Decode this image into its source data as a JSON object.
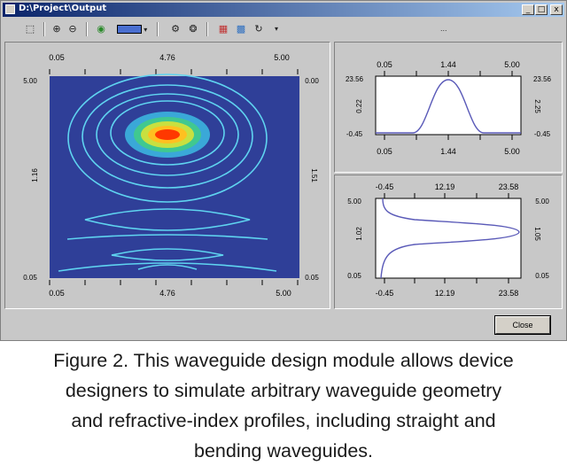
{
  "window": {
    "title": "D:\\Project\\Output",
    "controls": [
      "_",
      "□",
      "x"
    ],
    "close_label": "Close",
    "right_toolbar_dots": "..."
  },
  "toolbar": {
    "icons": [
      "pointer-icon",
      "zoom-in-icon",
      "zoom-out-icon",
      "view-icon",
      "color-bar-dropdown",
      "settings-icon",
      "render-icon",
      "palette-icon",
      "map-icon",
      "rotate-icon",
      "more-icon"
    ]
  },
  "colors": {
    "plot_background": "#2f3f98",
    "contour": "#5fd4f0",
    "curve": "#5a5ab8",
    "hot_core": "#ff3800"
  },
  "main_plot": {
    "top_ticks": [
      "0.05",
      "4.76",
      "5.00"
    ],
    "bottom_ticks": [
      "0.05",
      "4.76",
      "5.00"
    ],
    "left_ticks": [
      "5.00",
      "1.16",
      "0.05"
    ],
    "right_ticks": [
      "0.00",
      "1.51",
      "0.05"
    ]
  },
  "top_right_plot": {
    "top_ticks": [
      "0.05",
      "1.44",
      "5.00"
    ],
    "bottom_ticks": [
      "0.05",
      "1.44",
      "5.00"
    ],
    "left_ticks": [
      "23.56",
      "0.22",
      "-0.45"
    ],
    "right_ticks": [
      "23.56",
      "2.25",
      "-0.45"
    ]
  },
  "bottom_right_plot": {
    "top_ticks": [
      "-0.45",
      "12.19",
      "23.58"
    ],
    "bottom_ticks": [
      "-0.45",
      "12.19",
      "23.58"
    ],
    "left_ticks": [
      "5.00",
      "1.02",
      "0.05"
    ],
    "right_ticks": [
      "5.00",
      "1.05",
      "0.05"
    ]
  },
  "caption": {
    "lines": [
      "Figure 2. This waveguide design module allows device",
      "designers to simulate arbitrary waveguide geometry",
      "and refractive-index profiles, including straight and",
      "bending waveguides."
    ]
  }
}
